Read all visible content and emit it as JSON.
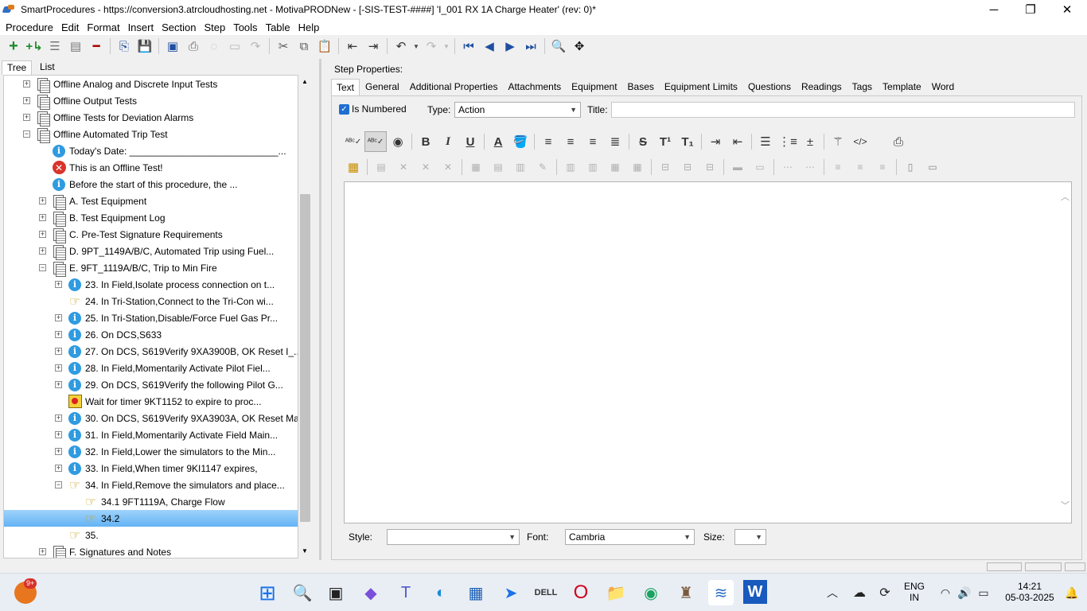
{
  "window": {
    "title": "SmartProcedures - https://conversion3.atrcloudhosting.net - MotivaPRODNew - [-SIS-TEST-####] 'I_001 RX 1A Charge Heater' (rev: 0)*",
    "controls": {
      "minimize": "─",
      "maximize": "❐",
      "close": "✕"
    }
  },
  "menu": [
    "Procedure",
    "Edit",
    "Format",
    "Insert",
    "Section",
    "Step",
    "Tools",
    "Table",
    "Help"
  ],
  "left_tabs": {
    "tree": "Tree",
    "list": "List"
  },
  "tree": [
    {
      "level": 0,
      "expander": "+",
      "icon": "doc",
      "label": "Offline Analog and Discrete Input Tests"
    },
    {
      "level": 0,
      "expander": "+",
      "icon": "doc",
      "label": "Offline Output Tests"
    },
    {
      "level": 0,
      "expander": "+",
      "icon": "doc",
      "label": "Offline Tests for Deviation Alarms"
    },
    {
      "level": 0,
      "expander": "−",
      "icon": "doc",
      "label": "Offline Automated Trip Test"
    },
    {
      "level": 1,
      "expander": "",
      "icon": "info",
      "label": "Today's Date: ____________________________..."
    },
    {
      "level": 1,
      "expander": "",
      "icon": "warn",
      "label": "This is an Offline Test!"
    },
    {
      "level": 1,
      "expander": "",
      "icon": "info",
      "label": "Before the start of this procedure, the ..."
    },
    {
      "level": 1,
      "expander": "+",
      "icon": "doc",
      "label": "A. Test Equipment"
    },
    {
      "level": 1,
      "expander": "+",
      "icon": "doc",
      "label": "B. Test Equipment Log"
    },
    {
      "level": 1,
      "expander": "+",
      "icon": "doc",
      "label": "C. Pre-Test Signature Requirements"
    },
    {
      "level": 1,
      "expander": "+",
      "icon": "doc",
      "label": "D. 9PT_1149A/B/C, Automated Trip using Fuel..."
    },
    {
      "level": 1,
      "expander": "−",
      "icon": "doc",
      "label": "E. 9FT_1119A/B/C, Trip to Min Fire"
    },
    {
      "level": 2,
      "expander": "+",
      "icon": "info",
      "label": "23. In Field,Isolate process connection on t..."
    },
    {
      "level": 2,
      "expander": "",
      "icon": "hand",
      "label": "24. In Tri-Station,Connect to the Tri-Con wi..."
    },
    {
      "level": 2,
      "expander": "+",
      "icon": "info",
      "label": "25. In Tri-Station,Disable/Force Fuel Gas Pr..."
    },
    {
      "level": 2,
      "expander": "+",
      "icon": "info",
      "label": "26. On DCS,S633"
    },
    {
      "level": 2,
      "expander": "+",
      "icon": "info",
      "label": "27. On DCS, S619Verify 9XA3900B, OK Reset I_..."
    },
    {
      "level": 2,
      "expander": "+",
      "icon": "info",
      "label": "28. In Field,Momentarily Activate Pilot Fiel..."
    },
    {
      "level": 2,
      "expander": "+",
      "icon": "info",
      "label": "29. On DCS, S619Verify the following Pilot G..."
    },
    {
      "level": 2,
      "expander": "",
      "icon": "timer",
      "label": "Wait for timer 9KT1152 to expire to proc..."
    },
    {
      "level": 2,
      "expander": "+",
      "icon": "info",
      "label": "30. On DCS, S619Verify 9XA3903A, OK Reset Ma..."
    },
    {
      "level": 2,
      "expander": "+",
      "icon": "info",
      "label": "31. In Field,Momentarily Activate Field Main..."
    },
    {
      "level": 2,
      "expander": "+",
      "icon": "info",
      "label": "32. In Field,Lower the simulators to the Min..."
    },
    {
      "level": 2,
      "expander": "+",
      "icon": "info",
      "label": "33. In Field,When timer 9KI1147 expires,"
    },
    {
      "level": 2,
      "expander": "−",
      "icon": "hand",
      "label": "34. In Field,Remove the simulators and place..."
    },
    {
      "level": 3,
      "expander": "",
      "icon": "hand",
      "label": "34.1 9FT1119A, Charge Flow"
    },
    {
      "level": 3,
      "expander": "",
      "icon": "hand",
      "label": "34.2",
      "selected": true
    },
    {
      "level": 2,
      "expander": "",
      "icon": "hand",
      "label": "35."
    },
    {
      "level": 1,
      "expander": "+",
      "icon": "doc",
      "label": "F. Signatures and Notes"
    }
  ],
  "step_properties": {
    "heading": "Step Properties:",
    "tabs": [
      "Text",
      "General",
      "Additional Properties",
      "Attachments",
      "Equipment",
      "Bases",
      "Equipment Limits",
      "Questions",
      "Readings",
      "Tags",
      "Template",
      "Word"
    ],
    "active_tab": "Text",
    "is_numbered_label": "Is Numbered",
    "is_numbered_checked": true,
    "type_label": "Type:",
    "type_value": "Action",
    "title_label": "Title:",
    "title_value": "",
    "style_label": "Style:",
    "style_value": "",
    "font_label": "Font:",
    "font_value": "Cambria",
    "size_label": "Size:",
    "size_value": ""
  },
  "taskbar": {
    "notification_badge": "9+",
    "language": "ENG",
    "region": "IN",
    "time": "14:21",
    "date": "05-03-2025"
  },
  "colors": {
    "selection": "#64b3f4",
    "checkbox": "#1e6fd0",
    "accent": "#1f4fa0"
  }
}
